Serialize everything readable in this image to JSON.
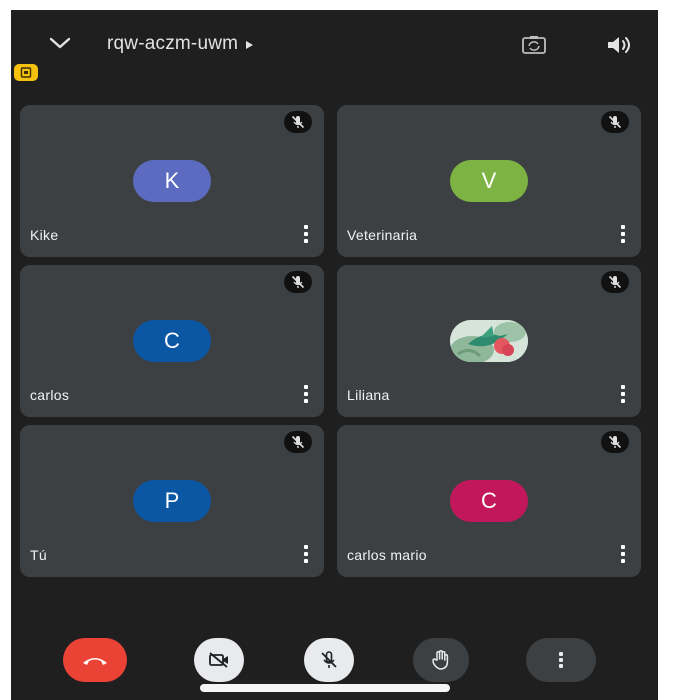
{
  "header": {
    "meeting_code": "rqw-aczm-uwm",
    "collapse_icon": "chevron-down-icon",
    "expand_icon": "play-triangle-icon",
    "switch_camera_icon": "switch-camera-icon",
    "speaker_icon": "speaker-icon",
    "badge_icon": "keep-awake-icon"
  },
  "participants": [
    {
      "name": "Kike",
      "initial": "K",
      "avatar_color": "#5c6bc0",
      "muted": true
    },
    {
      "name": "Veterinaria",
      "initial": "V",
      "avatar_color": "#7cb342",
      "muted": true
    },
    {
      "name": "carlos",
      "initial": "C",
      "avatar_color": "#0b57a4",
      "muted": true
    },
    {
      "name": "Liliana",
      "initial": "",
      "avatar_color": "#cfe0d6",
      "avatar_type": "photo",
      "muted": true
    },
    {
      "name": "Tú",
      "initial": "P",
      "avatar_color": "#0b57a4",
      "muted": true
    },
    {
      "name": "carlos mario",
      "initial": "C",
      "avatar_color": "#c2185b",
      "muted": true
    }
  ],
  "controls": {
    "end_call_icon": "phone-hangup-icon",
    "camera_icon": "camera-off-icon",
    "mic_icon": "mic-off-icon",
    "hand_icon": "raise-hand-icon",
    "more_icon": "more-vert-icon"
  },
  "colors": {
    "background": "#1f1f1f",
    "tile": "#3c4043",
    "end_call": "#ea4335",
    "toggle_off": "#e8eaed",
    "badge": "#f4c20d"
  }
}
